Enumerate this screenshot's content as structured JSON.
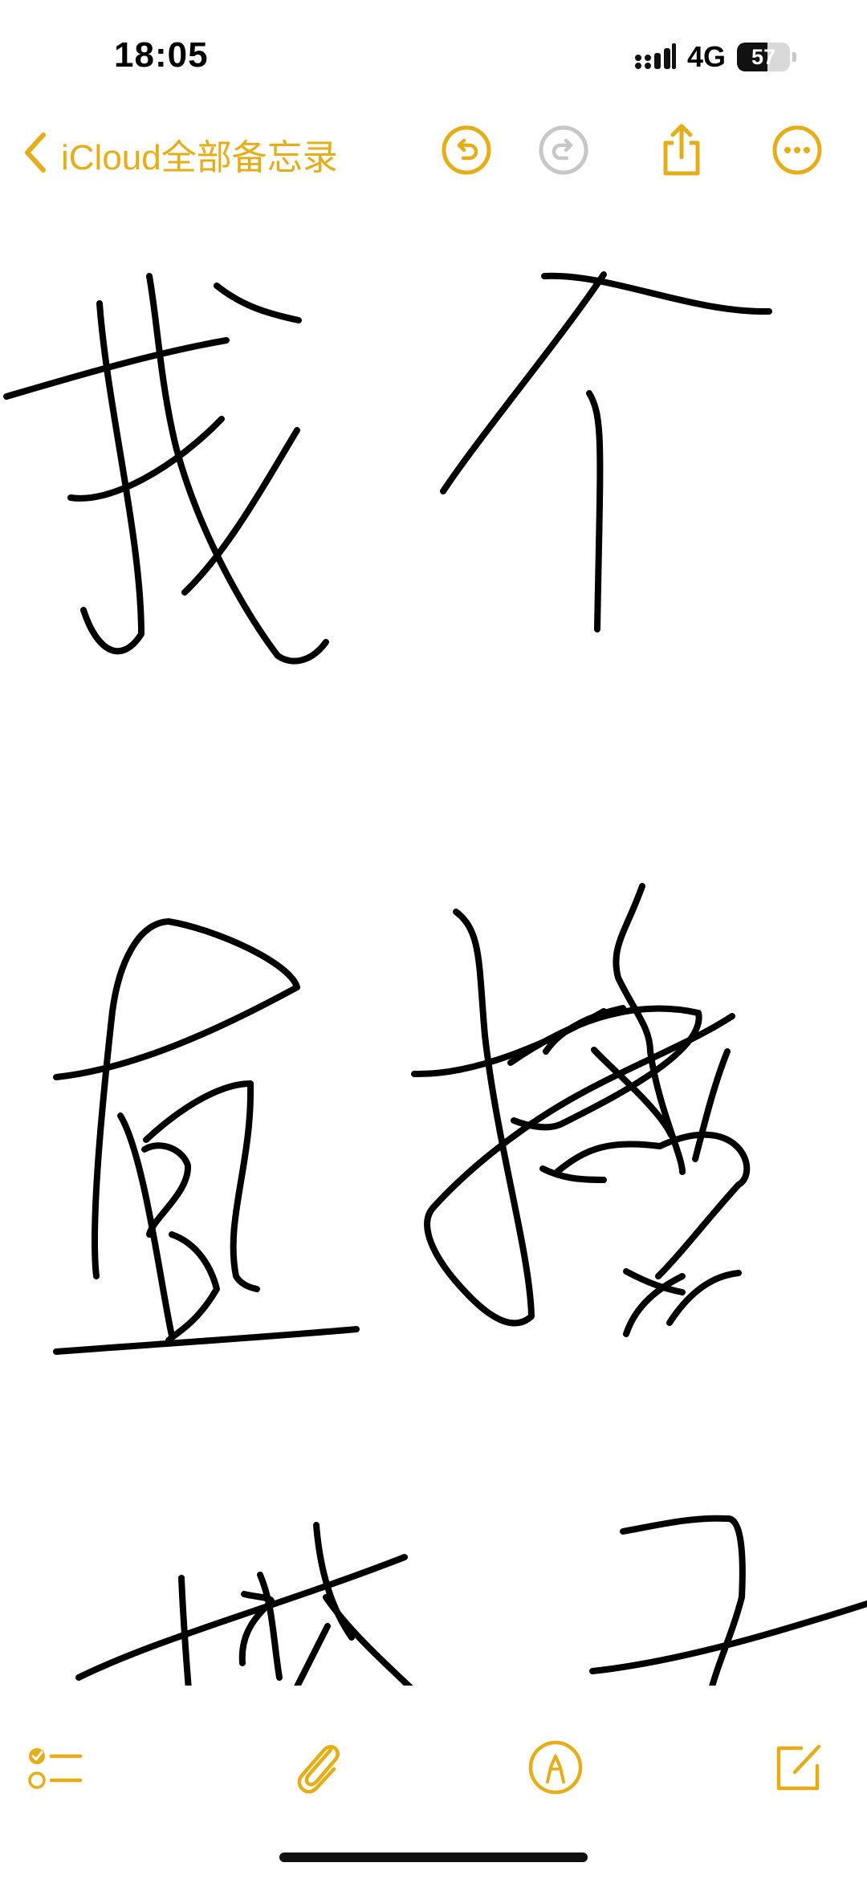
{
  "status_bar": {
    "time": "18:05",
    "network": "4G",
    "battery_level": "57",
    "battery_fraction": 0.57
  },
  "nav": {
    "back_label": "iCloud全部备忘录",
    "icons": [
      "chevron-left-icon",
      "undo-icon",
      "redo-icon",
      "share-icon",
      "more-icon"
    ],
    "accent_color": "#e5ad17",
    "disabled_color": "#c7c7c7"
  },
  "toolbar": {
    "icons": [
      "checklist-icon",
      "paperclip-icon",
      "markup-pen-icon",
      "compose-icon"
    ]
  },
  "note": {
    "content_type": "handwriting-drawing"
  }
}
